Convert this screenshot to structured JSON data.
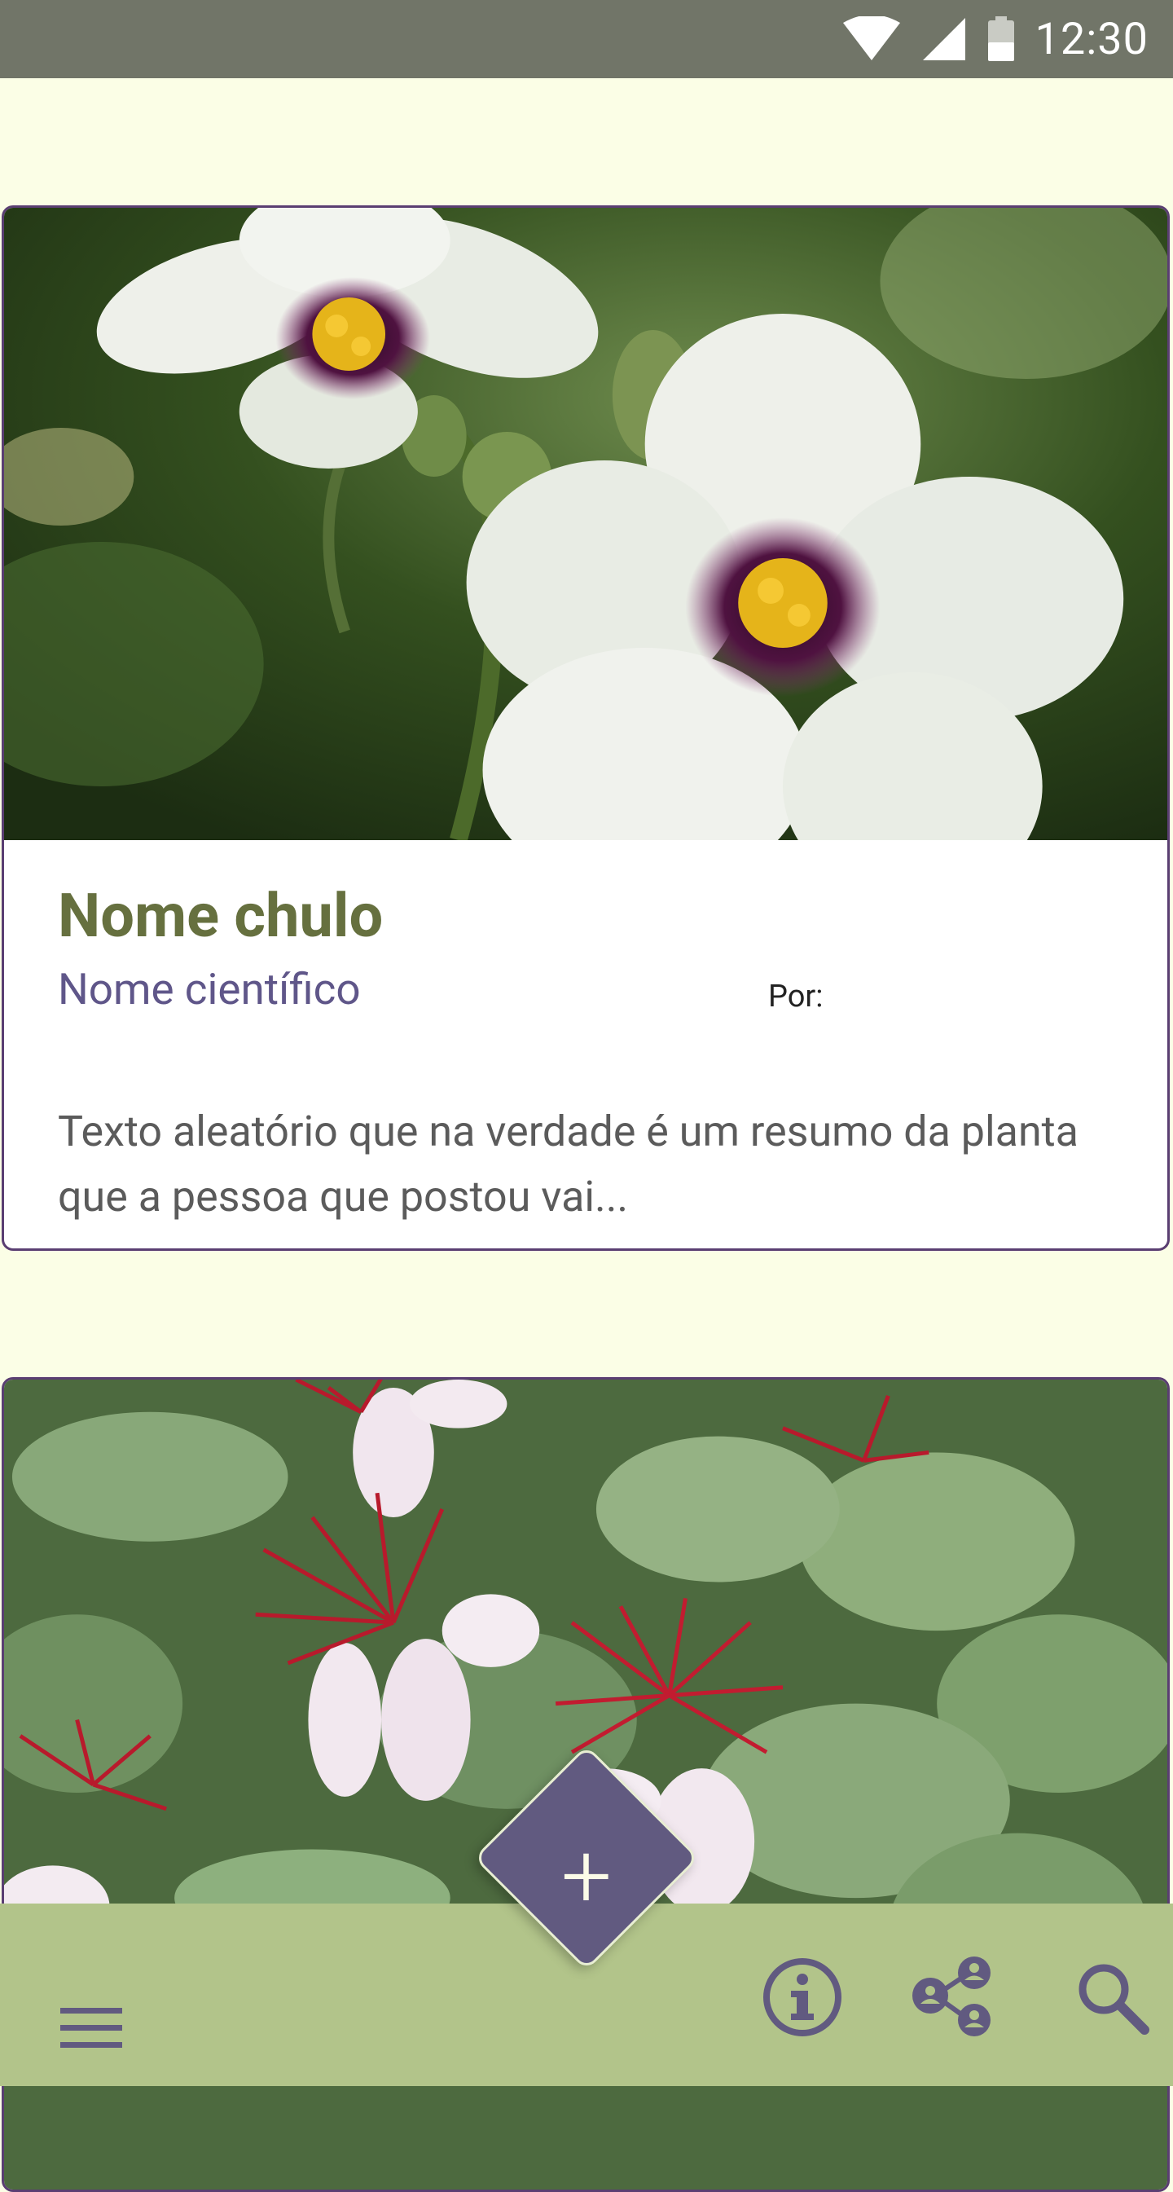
{
  "status_bar": {
    "time": "12:30",
    "icons": [
      "wifi-icon",
      "cell-signal-icon",
      "battery-icon"
    ]
  },
  "cards": [
    {
      "image": "white-hibiscus-flowers-photo",
      "title": "Nome chulo",
      "scientific_name": "Nome científico",
      "author_label": "Por:",
      "description": "Texto aleatório que na verdade é um resumo da planta que a pessoa que postou vai..."
    },
    {
      "image": "red-white-feijoa-flowers-photo"
    }
  ],
  "bottom_bar": {
    "icons": [
      "menu-icon",
      "info-icon",
      "community-icon",
      "search-icon"
    ],
    "fab_label": "+"
  },
  "colors": {
    "background": "#fbfee6",
    "status_bar": "#717568",
    "bottom_bar": "#b2c48a",
    "accent_purple": "#615a80",
    "card_border": "#5a3e72",
    "title_green": "#66703f"
  }
}
